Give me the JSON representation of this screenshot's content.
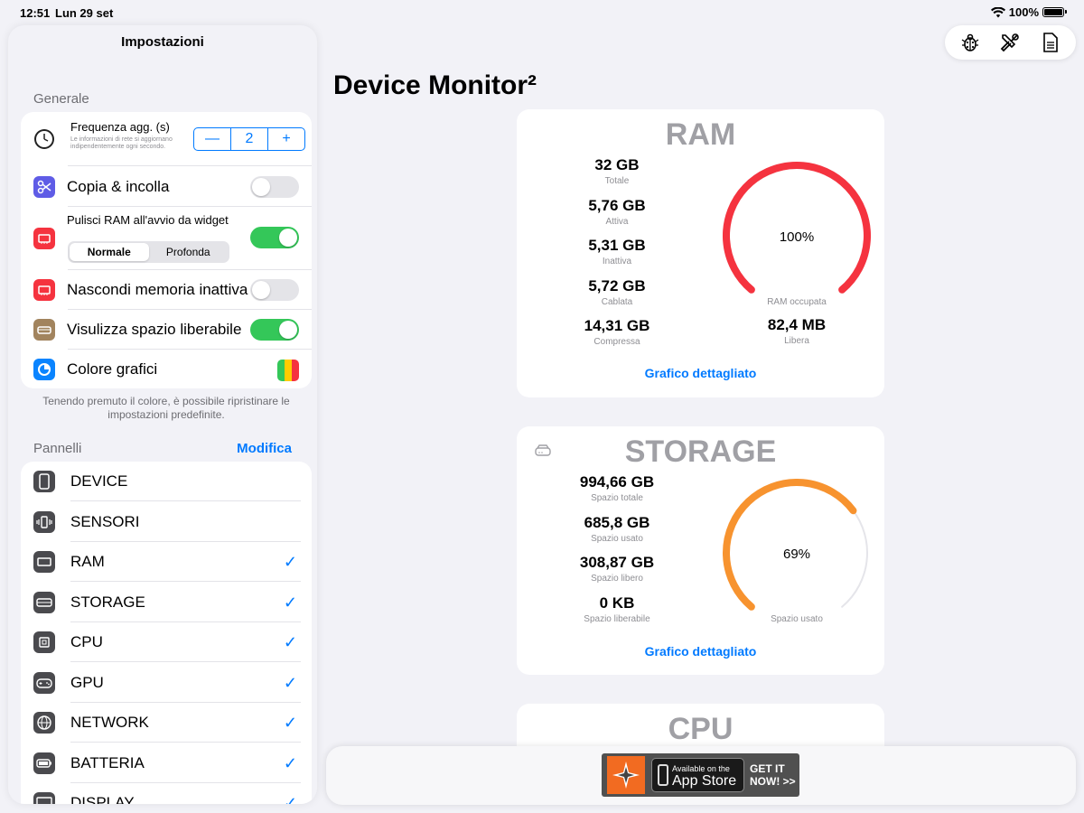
{
  "status_bar": {
    "time": "12:51",
    "date": "Lun 29 set",
    "battery": "100%"
  },
  "sidebar": {
    "title": "Impostazioni",
    "general_header": "Generale",
    "refresh": {
      "label": "Frequenza agg. (s)",
      "note": "Le informazioni di rete si aggiornano indipendentemente ogni secondo.",
      "value": "2",
      "minus": "—",
      "plus": "+"
    },
    "copy_paste": {
      "label": "Copia & incolla",
      "on": false
    },
    "clean_ram": {
      "label": "Pulisci RAM all'avvio da widget",
      "on": true,
      "options": [
        "Normale",
        "Profonda"
      ],
      "selected": "Normale"
    },
    "hide_inactive": {
      "label": "Nascondi memoria inattiva",
      "on": false
    },
    "show_freeable": {
      "label": "Visulizza spazio liberabile",
      "on": true
    },
    "chart_colors": {
      "label": "Colore grafici"
    },
    "footnote": "Tenendo premuto il colore, è possibile ripristinare le impostazioni predefinite.",
    "panels_header": "Pannelli",
    "edit": "Modifica",
    "panels": [
      {
        "label": "DEVICE",
        "icon": "ipad-icon",
        "checked": false
      },
      {
        "label": "SENSORI",
        "icon": "vibration-icon",
        "checked": false
      },
      {
        "label": "RAM",
        "icon": "memory-icon",
        "checked": true
      },
      {
        "label": "STORAGE",
        "icon": "drive-icon",
        "checked": true
      },
      {
        "label": "CPU",
        "icon": "cpu-icon",
        "checked": true
      },
      {
        "label": "GPU",
        "icon": "gamecontroller-icon",
        "checked": true
      },
      {
        "label": "NETWORK",
        "icon": "globe-icon",
        "checked": true
      },
      {
        "label": "BATTERIA",
        "icon": "battery-icon",
        "checked": true
      },
      {
        "label": "DISPLAY",
        "icon": "display-icon",
        "checked": true
      }
    ]
  },
  "main": {
    "title": "Device Monitor²",
    "ram": {
      "title": "RAM",
      "stats": [
        {
          "value": "32 GB",
          "label": "Totale"
        },
        {
          "value": "5,76 GB",
          "label": "Attiva"
        },
        {
          "value": "5,31 GB",
          "label": "Inattiva"
        },
        {
          "value": "5,72 GB",
          "label": "Cablata"
        },
        {
          "value": "14,31 GB",
          "label": "Compressa"
        }
      ],
      "gauge_value": "100%",
      "gauge_fraction": 1.0,
      "gauge_label": "RAM occupata",
      "free_value": "82,4 MB",
      "free_label": "Libera",
      "link": "Grafico dettagliato",
      "color": "#f5333f"
    },
    "storage": {
      "title": "STORAGE",
      "stats": [
        {
          "value": "994,66 GB",
          "label": "Spazio totale"
        },
        {
          "value": "685,8 GB",
          "label": "Spazio usato"
        },
        {
          "value": "308,87 GB",
          "label": "Spazio libero"
        },
        {
          "value": "0 KB",
          "label": "Spazio liberabile"
        }
      ],
      "gauge_value": "69%",
      "gauge_fraction": 0.69,
      "gauge_label": "Spazio usato",
      "link": "Grafico dettagliato",
      "color": "#f7932f"
    },
    "cpu": {
      "title": "CPU"
    }
  },
  "ad": {
    "small": "Available on the",
    "big": "App Store",
    "get1": "GET IT",
    "get2": "NOW! >>"
  }
}
